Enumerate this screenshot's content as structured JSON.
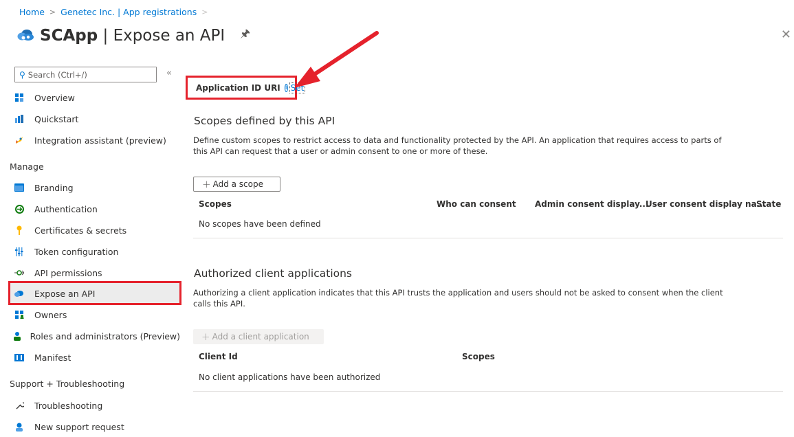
{
  "breadcrumb": {
    "items": [
      "Home",
      "Genetec Inc. | App registrations"
    ]
  },
  "page": {
    "title_app": "SCApp",
    "title_sep": " | ",
    "title_page": "Expose an API"
  },
  "sidebar": {
    "search_placeholder": "Search (Ctrl+/)",
    "collapse_glyph": "«",
    "items_top": [
      {
        "label": "Overview",
        "icon": "overview-icon"
      },
      {
        "label": "Quickstart",
        "icon": "quickstart-icon"
      },
      {
        "label": "Integration assistant (preview)",
        "icon": "rocket-icon"
      }
    ],
    "section_manage": "Manage",
    "items_manage": [
      {
        "label": "Branding",
        "icon": "branding-icon"
      },
      {
        "label": "Authentication",
        "icon": "authentication-icon"
      },
      {
        "label": "Certificates & secrets",
        "icon": "key-icon"
      },
      {
        "label": "Token configuration",
        "icon": "token-icon"
      },
      {
        "label": "API permissions",
        "icon": "api-permissions-icon"
      },
      {
        "label": "Expose an API",
        "icon": "cloud-icon"
      },
      {
        "label": "Owners",
        "icon": "owners-icon"
      },
      {
        "label": "Roles and administrators (Preview)",
        "icon": "roles-icon"
      },
      {
        "label": "Manifest",
        "icon": "manifest-icon"
      }
    ],
    "section_support": "Support + Troubleshooting",
    "items_support": [
      {
        "label": "Troubleshooting",
        "icon": "wrench-icon"
      },
      {
        "label": "New support request",
        "icon": "support-icon"
      }
    ]
  },
  "app_id": {
    "label": "Application ID URI",
    "set_label": "Set"
  },
  "scopes": {
    "heading": "Scopes defined by this API",
    "description": "Define custom scopes to restrict access to data and functionality protected by the API. An application that requires access to parts of this API can request that a user or admin consent to one or more of these.",
    "add_button": "Add a scope",
    "columns": [
      "Scopes",
      "Who can consent",
      "Admin consent display...",
      "User consent display na...",
      "State"
    ],
    "empty_message": "No scopes have been defined"
  },
  "clients": {
    "heading": "Authorized client applications",
    "description": "Authorizing a client application indicates that this API trusts the application and users should not be asked to consent when the client calls this API.",
    "add_button": "Add a client application",
    "columns": [
      "Client Id",
      "Scopes"
    ],
    "empty_message": "No client applications have been authorized"
  },
  "colors": {
    "accent": "#0078d4",
    "highlight": "#e5222c",
    "active_bg": "#ececec"
  }
}
